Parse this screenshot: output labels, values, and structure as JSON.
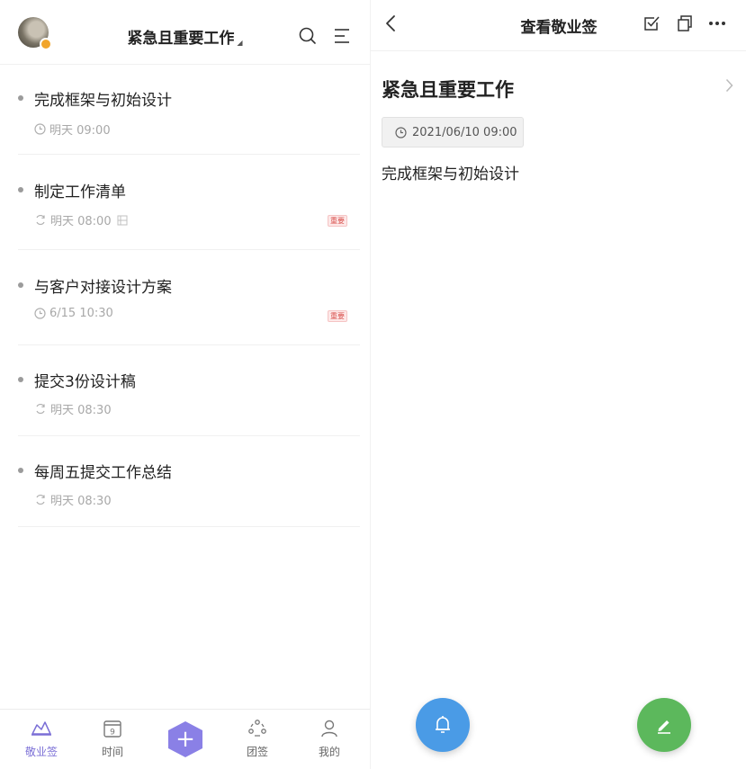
{
  "left": {
    "header": {
      "title": "紧急且重要工作"
    },
    "items": [
      {
        "title": "完成框架与初始设计",
        "time": "明天 09:00",
        "icon": "clock-icon",
        "tag": ""
      },
      {
        "title": "制定工作清单",
        "time": "明天 08:00",
        "icon": "repeat-icon",
        "tag": "重要"
      },
      {
        "title": "与客户对接设计方案",
        "time": "6/15 10:30",
        "icon": "clock-icon",
        "tag": "重要"
      },
      {
        "title": "提交3份设计稿",
        "time": "明天 08:30",
        "icon": "repeat-icon",
        "tag": ""
      },
      {
        "title": "每周五提交工作总结",
        "time": "明天 08:30",
        "icon": "repeat-icon",
        "tag": ""
      }
    ],
    "nav": [
      {
        "label": "敬业签",
        "icon": "notes-icon",
        "active": true
      },
      {
        "label": "时间",
        "icon": "calendar-icon",
        "active": false
      },
      {
        "label": "团签",
        "icon": "team-icon",
        "active": false
      },
      {
        "label": "我的",
        "icon": "profile-icon",
        "active": false
      }
    ],
    "calendar_day": "9"
  },
  "right": {
    "header": {
      "title": "查看敬业签"
    },
    "note": {
      "title": "紧急且重要工作",
      "date": "2021/06/10 09:00",
      "content": "完成框架与初始设计"
    }
  },
  "colors": {
    "accent": "#7b6fd6",
    "add_button": "#8a80e6",
    "bell_button": "#4a9be6",
    "edit_button": "#5cb85c",
    "tag_red": "#d9534f"
  }
}
